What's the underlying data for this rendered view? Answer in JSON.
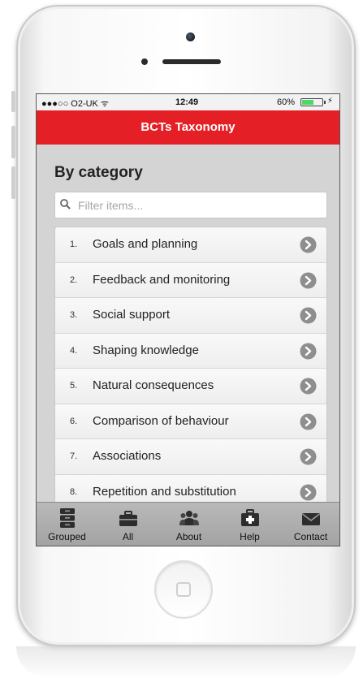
{
  "status_bar": {
    "carrier": "●●●○○ O2-UK ᯤ",
    "time": "12:49",
    "battery": "60%",
    "charging": "⚡",
    "battery_level": 0.6
  },
  "nav": {
    "title": "BCTs Taxonomy"
  },
  "page": {
    "heading": "By category"
  },
  "search": {
    "placeholder": "Filter items..."
  },
  "categories": [
    {
      "number": "1.",
      "label": "Goals and planning"
    },
    {
      "number": "2.",
      "label": "Feedback and monitoring"
    },
    {
      "number": "3.",
      "label": "Social support"
    },
    {
      "number": "4.",
      "label": "Shaping knowledge"
    },
    {
      "number": "5.",
      "label": "Natural consequences"
    },
    {
      "number": "6.",
      "label": "Comparison of behaviour"
    },
    {
      "number": "7.",
      "label": "Associations"
    },
    {
      "number": "8.",
      "label": "Repetition and substitution"
    }
  ],
  "tabs": [
    {
      "label": "Grouped",
      "icon": "stack-icon"
    },
    {
      "label": "All",
      "icon": "toolbox-icon"
    },
    {
      "label": "About",
      "icon": "people-icon"
    },
    {
      "label": "Help",
      "icon": "first-aid-icon"
    },
    {
      "label": "Contact",
      "icon": "envelope-icon"
    }
  ],
  "colors": {
    "accent": "#e41f25",
    "list_arrow": "#8e8e8e",
    "tab_bar": "#aaaaaa"
  }
}
